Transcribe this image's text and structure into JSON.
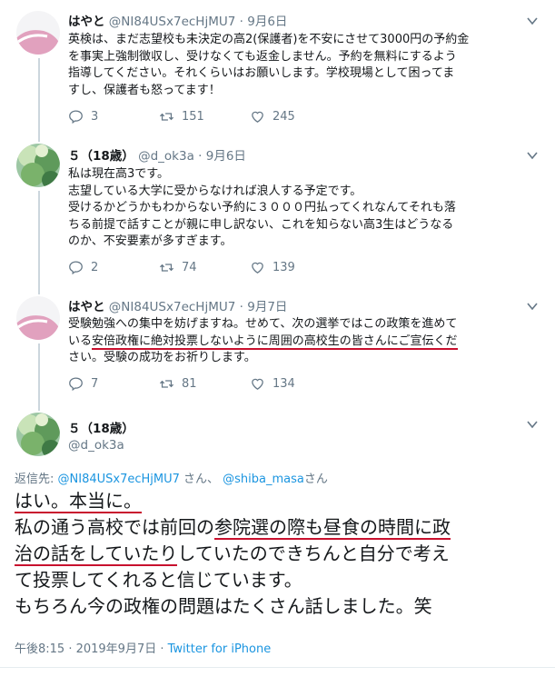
{
  "tweets": [
    {
      "name": "はやと",
      "handle": "@NI84USx7ecHjMU7",
      "sep": "·",
      "date": "9月6日",
      "lines": [
        "英検は、まだ志望校も未決定の高2(保護者)を不安にさせて3000円の予約金",
        "を事実上強制徴収し、受けなくても返金しません。予約を無料にするよう",
        "指導してください。それくらいはお願いします。学校現場として困ってま",
        "すし、保護者も怒ってます！"
      ],
      "replies": "3",
      "retweets": "151",
      "likes": "245"
    },
    {
      "name": "５（18歳）",
      "handle": "@d_ok3a",
      "sep": "·",
      "date": "9月6日",
      "lines": [
        "私は現在高3です。",
        "志望している大学に受からなければ浪人する予定です。",
        "受けるかどうかもわからない予約に３０００円払ってくれなんてそれも落",
        "ちる前提で話すことが親に申し訳ない、これを知らない高3生はどうなる",
        "のか、不安要素が多すぎます。"
      ],
      "replies": "2",
      "retweets": "74",
      "likes": "139"
    },
    {
      "name": "はやと",
      "handle": "@NI84USx7ecHjMU7",
      "sep": "·",
      "date": "9月7日",
      "line1": "受験勉強への集中を妨げますね。せめて、次の選挙ではこの政策を進めて",
      "line2_pre": "いる",
      "line2_ul": "安倍政権に絶対投票しないように周囲の高校生の皆さんにご宣伝くだ",
      "line3": "さい。受験の成功をお祈りします。",
      "replies": "7",
      "retweets": "81",
      "likes": "134"
    }
  ],
  "focus": {
    "name": "５（18歳）",
    "handle": "@d_ok3a",
    "replying_prefix": "返信先: ",
    "reply_to_1": "@NI84USx7ecHjMU7",
    "reply_mid": " さん、 ",
    "reply_to_2": "@shiba_masa",
    "reply_suffix": "さん",
    "line1": "はい。本当に。",
    "line2_pre": "私の通う高校では前回の",
    "line2_ul": "参院選の際も昼食の時間に政",
    "line3_ul": "治の話をしていたり",
    "line3_post": "していたのできちんと自分で考え",
    "line4": "て投票してくれると信じています。",
    "line5": "もちろん今の政権の問題はたくさん話しました。笑",
    "time": "午後8:15 · 2019年9月7日 · ",
    "source": "Twitter for iPhone"
  }
}
